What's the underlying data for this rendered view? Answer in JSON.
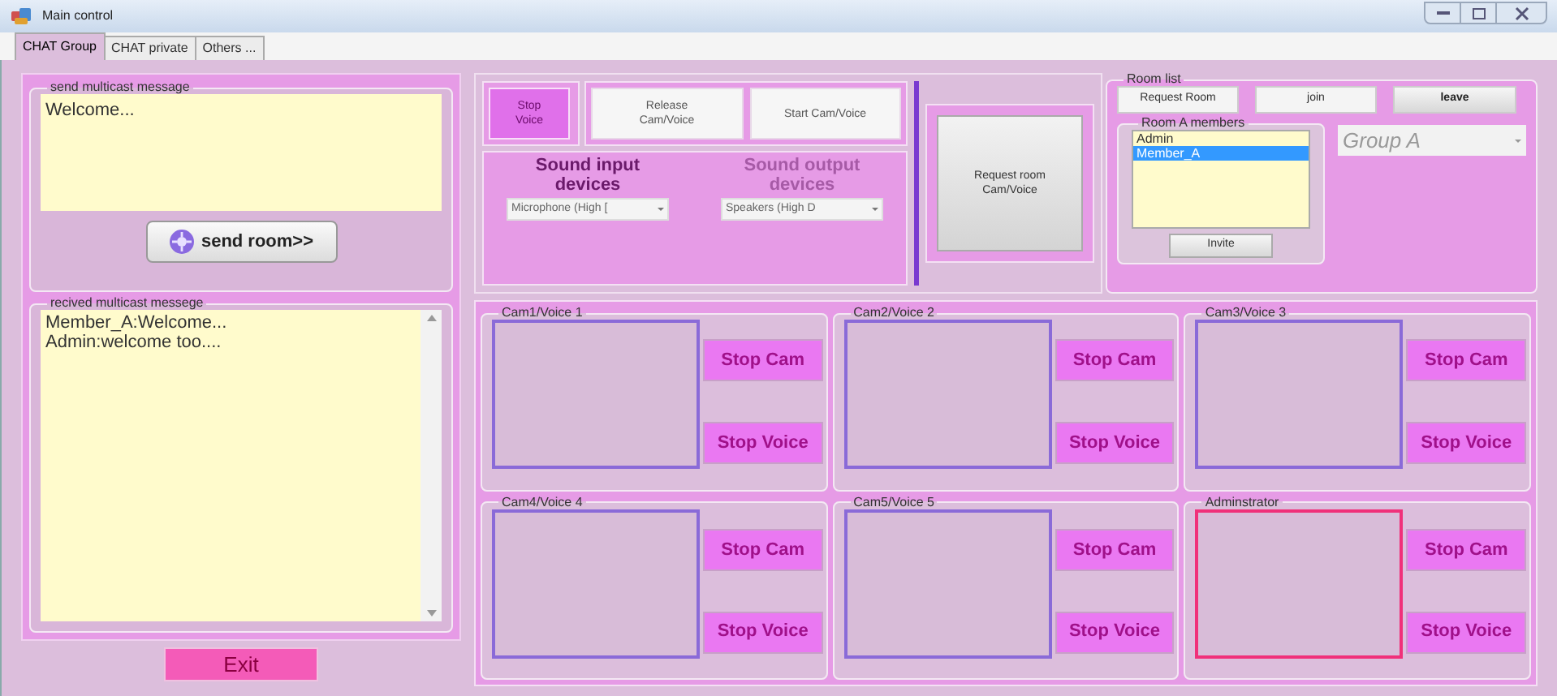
{
  "window": {
    "title": "Main control"
  },
  "tabs": [
    {
      "label": "CHAT Group",
      "selected": true
    },
    {
      "label": "CHAT private",
      "selected": false
    },
    {
      "label": "Others ...",
      "selected": false
    }
  ],
  "send_group": {
    "title": "send multicast  message",
    "message": "Welcome...",
    "button": "send room>>"
  },
  "received_group": {
    "title": "recived multicast messege",
    "lines": [
      "Member_A:Welcome...",
      "Admin:welcome too...."
    ]
  },
  "exit_button": "Exit",
  "voice_buttons": [
    {
      "label": "Stop Voice",
      "kind": "active"
    },
    {
      "label": "Release Cam/Voice",
      "kind": "plain"
    },
    {
      "label": "Start Cam/Voice",
      "kind": "plain"
    }
  ],
  "sound_devices": [
    {
      "label": "Sound input devices",
      "value": "Microphone (High [",
      "disabled": false
    },
    {
      "label": "Sound output devices",
      "value": "Speakers (High D",
      "disabled": true
    }
  ],
  "request_button": "Request room Cam/Voice",
  "room_list": {
    "title": "Room list",
    "buttons": [
      "Request Room",
      "join",
      "leave"
    ],
    "members_title": "Room A members",
    "members": [
      {
        "name": "Admin",
        "selected": false
      },
      {
        "name": "Member_A",
        "selected": true
      }
    ],
    "invite_button": "Invite",
    "group_select": "Group A"
  },
  "cams": [
    {
      "title": "Cam1/Voice 1",
      "active": false,
      "buttons": [
        "Stop Cam",
        "Stop Voice"
      ]
    },
    {
      "title": "Cam2/Voice 2",
      "active": false,
      "buttons": [
        "Stop Cam",
        "Stop Voice"
      ]
    },
    {
      "title": "Cam3/Voice 3",
      "active": false,
      "buttons": [
        "Stop Cam",
        "Stop Voice"
      ]
    },
    {
      "title": "Cam4/Voice 4",
      "active": false,
      "buttons": [
        "Stop Cam",
        "Stop Voice"
      ]
    },
    {
      "title": "Cam5/Voice 5",
      "active": false,
      "buttons": [
        "Stop Cam",
        "Stop Voice"
      ]
    },
    {
      "title": "Adminstrator",
      "active": true,
      "buttons": [
        "Stop Cam",
        "Stop Voice"
      ]
    }
  ]
}
